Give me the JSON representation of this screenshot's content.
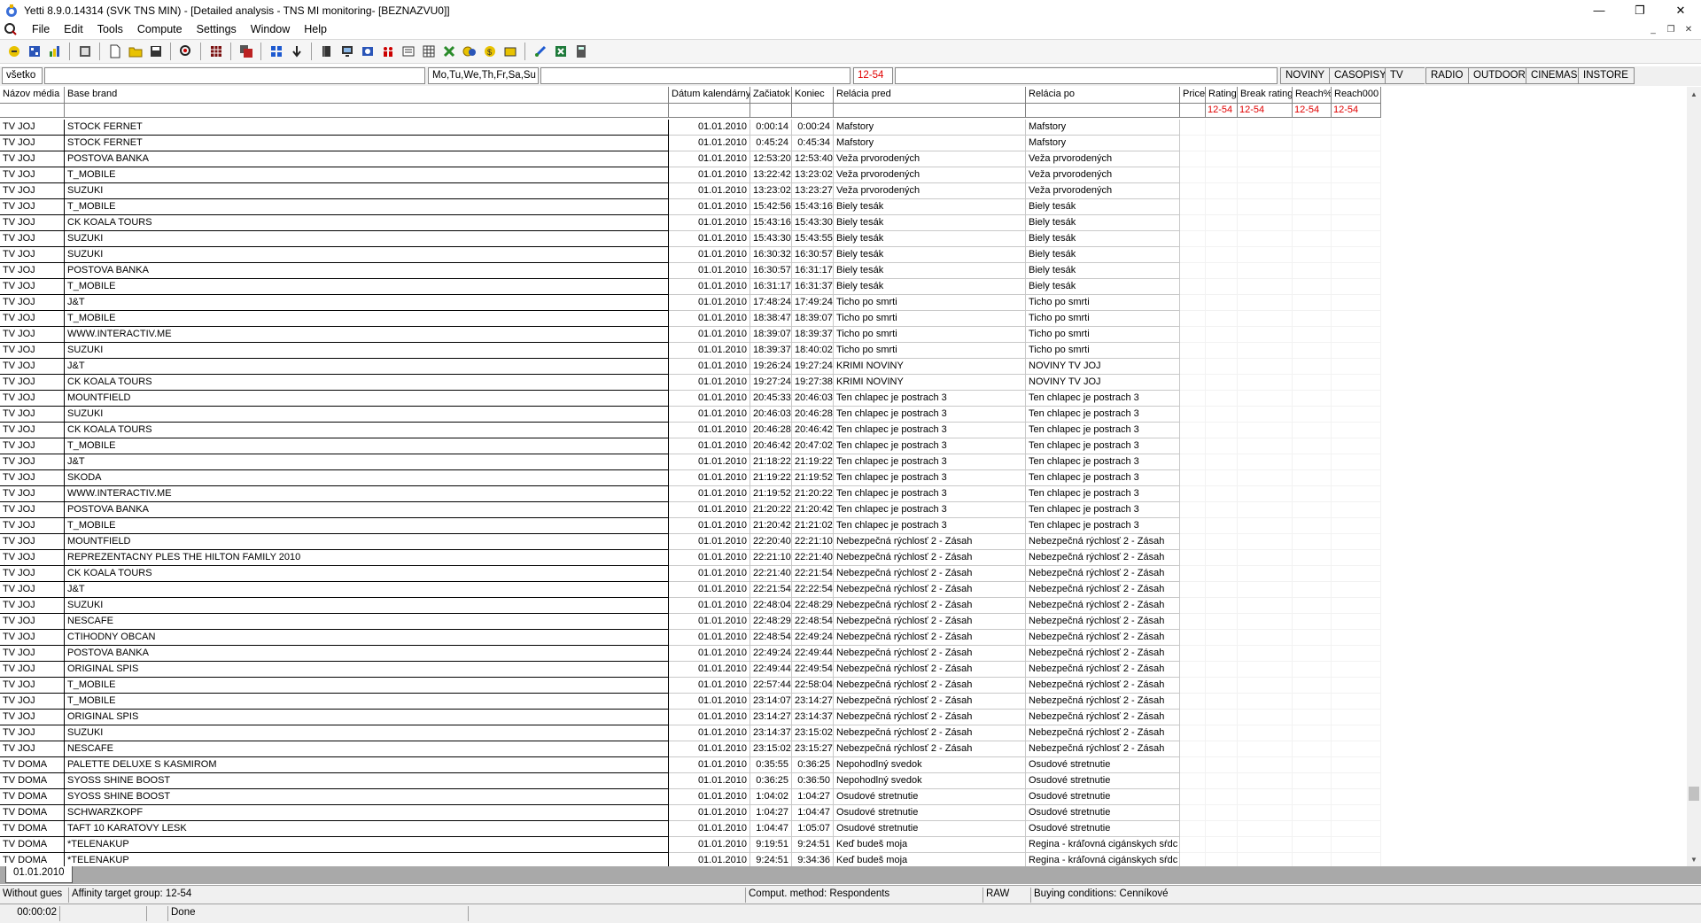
{
  "window": {
    "title": "Yetti 8.9.0.14314 (SVK TNS MIN) - [Detailed analysis - TNS MI monitoring- [BEZNAZVU0]]"
  },
  "menu": [
    "File",
    "Edit",
    "Tools",
    "Compute",
    "Settings",
    "Window",
    "Help"
  ],
  "filter": {
    "all": "všetko",
    "days": "Mo,Tu,We,Th,Fr,Sa,Su",
    "age": "12-54"
  },
  "media_tabs": [
    "NOVINY",
    "CASOPISY",
    "TV",
    "RADIO",
    "OUTDOOR",
    "CINEMAS",
    "INSTORE"
  ],
  "columns": {
    "media": "Názov média",
    "brand": "Base brand",
    "date": "Dátum kalendárny",
    "start": "Začiatok",
    "end": "Koniec",
    "before": "Relácia pred",
    "after": "Relácia po",
    "price": "Price",
    "rating": "Rating",
    "break_rating": "Break rating",
    "reach_pct": "Reach%",
    "reach000": "Reach000"
  },
  "target_labels": [
    "12-54",
    "12-54",
    "12-54",
    "12-54"
  ],
  "rows": [
    [
      "TV JOJ",
      "STOCK FERNET",
      "01.01.2010",
      "0:00:14",
      "0:00:24",
      "Mafstory",
      "Mafstory"
    ],
    [
      "TV JOJ",
      "STOCK FERNET",
      "01.01.2010",
      "0:45:24",
      "0:45:34",
      "Mafstory",
      "Mafstory"
    ],
    [
      "TV JOJ",
      "POSTOVA BANKA",
      "01.01.2010",
      "12:53:20",
      "12:53:40",
      "Veža prvorodených",
      "Veža prvorodených"
    ],
    [
      "TV JOJ",
      "T_MOBILE",
      "01.01.2010",
      "13:22:42",
      "13:23:02",
      "Veža prvorodených",
      "Veža prvorodených"
    ],
    [
      "TV JOJ",
      "SUZUKI",
      "01.01.2010",
      "13:23:02",
      "13:23:27",
      "Veža prvorodených",
      "Veža prvorodených"
    ],
    [
      "TV JOJ",
      "T_MOBILE",
      "01.01.2010",
      "15:42:56",
      "15:43:16",
      "Biely tesák",
      "Biely tesák"
    ],
    [
      "TV JOJ",
      "CK KOALA TOURS",
      "01.01.2010",
      "15:43:16",
      "15:43:30",
      "Biely tesák",
      "Biely tesák"
    ],
    [
      "TV JOJ",
      "SUZUKI",
      "01.01.2010",
      "15:43:30",
      "15:43:55",
      "Biely tesák",
      "Biely tesák"
    ],
    [
      "TV JOJ",
      "SUZUKI",
      "01.01.2010",
      "16:30:32",
      "16:30:57",
      "Biely tesák",
      "Biely tesák"
    ],
    [
      "TV JOJ",
      "POSTOVA BANKA",
      "01.01.2010",
      "16:30:57",
      "16:31:17",
      "Biely tesák",
      "Biely tesák"
    ],
    [
      "TV JOJ",
      "T_MOBILE",
      "01.01.2010",
      "16:31:17",
      "16:31:37",
      "Biely tesák",
      "Biely tesák"
    ],
    [
      "TV JOJ",
      "J&T",
      "01.01.2010",
      "17:48:24",
      "17:49:24",
      "Ticho po smrti",
      "Ticho po smrti"
    ],
    [
      "TV JOJ",
      "T_MOBILE",
      "01.01.2010",
      "18:38:47",
      "18:39:07",
      "Ticho po smrti",
      "Ticho po smrti"
    ],
    [
      "TV JOJ",
      "WWW.INTERACTIV.ME",
      "01.01.2010",
      "18:39:07",
      "18:39:37",
      "Ticho po smrti",
      "Ticho po smrti"
    ],
    [
      "TV JOJ",
      "SUZUKI",
      "01.01.2010",
      "18:39:37",
      "18:40:02",
      "Ticho po smrti",
      "Ticho po smrti"
    ],
    [
      "TV JOJ",
      "J&T",
      "01.01.2010",
      "19:26:24",
      "19:27:24",
      "KRIMI NOVINY",
      "NOVINY TV JOJ"
    ],
    [
      "TV JOJ",
      "CK KOALA TOURS",
      "01.01.2010",
      "19:27:24",
      "19:27:38",
      "KRIMI NOVINY",
      "NOVINY TV JOJ"
    ],
    [
      "TV JOJ",
      "MOUNTFIELD",
      "01.01.2010",
      "20:45:33",
      "20:46:03",
      "Ten chlapec je postrach 3",
      "Ten chlapec je postrach 3"
    ],
    [
      "TV JOJ",
      "SUZUKI",
      "01.01.2010",
      "20:46:03",
      "20:46:28",
      "Ten chlapec je postrach 3",
      "Ten chlapec je postrach 3"
    ],
    [
      "TV JOJ",
      "CK KOALA TOURS",
      "01.01.2010",
      "20:46:28",
      "20:46:42",
      "Ten chlapec je postrach 3",
      "Ten chlapec je postrach 3"
    ],
    [
      "TV JOJ",
      "T_MOBILE",
      "01.01.2010",
      "20:46:42",
      "20:47:02",
      "Ten chlapec je postrach 3",
      "Ten chlapec je postrach 3"
    ],
    [
      "TV JOJ",
      "J&T",
      "01.01.2010",
      "21:18:22",
      "21:19:22",
      "Ten chlapec je postrach 3",
      "Ten chlapec je postrach 3"
    ],
    [
      "TV JOJ",
      "SKODA",
      "01.01.2010",
      "21:19:22",
      "21:19:52",
      "Ten chlapec je postrach 3",
      "Ten chlapec je postrach 3"
    ],
    [
      "TV JOJ",
      "WWW.INTERACTIV.ME",
      "01.01.2010",
      "21:19:52",
      "21:20:22",
      "Ten chlapec je postrach 3",
      "Ten chlapec je postrach 3"
    ],
    [
      "TV JOJ",
      "POSTOVA BANKA",
      "01.01.2010",
      "21:20:22",
      "21:20:42",
      "Ten chlapec je postrach 3",
      "Ten chlapec je postrach 3"
    ],
    [
      "TV JOJ",
      "T_MOBILE",
      "01.01.2010",
      "21:20:42",
      "21:21:02",
      "Ten chlapec je postrach 3",
      "Ten chlapec je postrach 3"
    ],
    [
      "TV JOJ",
      "MOUNTFIELD",
      "01.01.2010",
      "22:20:40",
      "22:21:10",
      "Nebezpečná rýchlosť 2 - Zásah",
      "Nebezpečná rýchlosť 2 - Zásah"
    ],
    [
      "TV JOJ",
      "REPREZENTACNY PLES THE HILTON FAMILY 2010",
      "01.01.2010",
      "22:21:10",
      "22:21:40",
      "Nebezpečná rýchlosť 2 - Zásah",
      "Nebezpečná rýchlosť 2 - Zásah"
    ],
    [
      "TV JOJ",
      "CK KOALA TOURS",
      "01.01.2010",
      "22:21:40",
      "22:21:54",
      "Nebezpečná rýchlosť 2 - Zásah",
      "Nebezpečná rýchlosť 2 - Zásah"
    ],
    [
      "TV JOJ",
      "J&T",
      "01.01.2010",
      "22:21:54",
      "22:22:54",
      "Nebezpečná rýchlosť 2 - Zásah",
      "Nebezpečná rýchlosť 2 - Zásah"
    ],
    [
      "TV JOJ",
      "SUZUKI",
      "01.01.2010",
      "22:48:04",
      "22:48:29",
      "Nebezpečná rýchlosť 2 - Zásah",
      "Nebezpečná rýchlosť 2 - Zásah"
    ],
    [
      "TV JOJ",
      "NESCAFE",
      "01.01.2010",
      "22:48:29",
      "22:48:54",
      "Nebezpečná rýchlosť 2 - Zásah",
      "Nebezpečná rýchlosť 2 - Zásah"
    ],
    [
      "TV JOJ",
      "CTIHODNY OBCAN",
      "01.01.2010",
      "22:48:54",
      "22:49:24",
      "Nebezpečná rýchlosť 2 - Zásah",
      "Nebezpečná rýchlosť 2 - Zásah"
    ],
    [
      "TV JOJ",
      "POSTOVA BANKA",
      "01.01.2010",
      "22:49:24",
      "22:49:44",
      "Nebezpečná rýchlosť 2 - Zásah",
      "Nebezpečná rýchlosť 2 - Zásah"
    ],
    [
      "TV JOJ",
      "ORIGINAL SPIS",
      "01.01.2010",
      "22:49:44",
      "22:49:54",
      "Nebezpečná rýchlosť 2 - Zásah",
      "Nebezpečná rýchlosť 2 - Zásah"
    ],
    [
      "TV JOJ",
      "T_MOBILE",
      "01.01.2010",
      "22:57:44",
      "22:58:04",
      "Nebezpečná rýchlosť 2 - Zásah",
      "Nebezpečná rýchlosť 2 - Zásah"
    ],
    [
      "TV JOJ",
      "T_MOBILE",
      "01.01.2010",
      "23:14:07",
      "23:14:27",
      "Nebezpečná rýchlosť 2 - Zásah",
      "Nebezpečná rýchlosť 2 - Zásah"
    ],
    [
      "TV JOJ",
      "ORIGINAL SPIS",
      "01.01.2010",
      "23:14:27",
      "23:14:37",
      "Nebezpečná rýchlosť 2 - Zásah",
      "Nebezpečná rýchlosť 2 - Zásah"
    ],
    [
      "TV JOJ",
      "SUZUKI",
      "01.01.2010",
      "23:14:37",
      "23:15:02",
      "Nebezpečná rýchlosť 2 - Zásah",
      "Nebezpečná rýchlosť 2 - Zásah"
    ],
    [
      "TV JOJ",
      "NESCAFE",
      "01.01.2010",
      "23:15:02",
      "23:15:27",
      "Nebezpečná rýchlosť 2 - Zásah",
      "Nebezpečná rýchlosť 2 - Zásah"
    ],
    [
      "TV DOMA",
      "PALETTE DELUXE S KASMIROM",
      "01.01.2010",
      "0:35:55",
      "0:36:25",
      "Nepohodlný svedok",
      "Osudové stretnutie"
    ],
    [
      "TV DOMA",
      "SYOSS SHINE BOOST",
      "01.01.2010",
      "0:36:25",
      "0:36:50",
      "Nepohodlný svedok",
      "Osudové stretnutie"
    ],
    [
      "TV DOMA",
      "SYOSS SHINE BOOST",
      "01.01.2010",
      "1:04:02",
      "1:04:27",
      "Osudové stretnutie",
      "Osudové stretnutie"
    ],
    [
      "TV DOMA",
      "SCHWARZKOPF",
      "01.01.2010",
      "1:04:27",
      "1:04:47",
      "Osudové stretnutie",
      "Osudové stretnutie"
    ],
    [
      "TV DOMA",
      "TAFT 10 KARATOVY LESK",
      "01.01.2010",
      "1:04:47",
      "1:05:07",
      "Osudové stretnutie",
      "Osudové stretnutie"
    ],
    [
      "TV DOMA",
      "*TELENAKUP",
      "01.01.2010",
      "9:19:51",
      "9:24:51",
      "Keď budeš moja",
      "Regina - kráľovná cigánskych sŕdc"
    ],
    [
      "TV DOMA",
      "*TELENAKUP",
      "01.01.2010",
      "9:24:51",
      "9:34:36",
      "Keď budeš moja",
      "Regina - kráľovná cigánskych sŕdc"
    ]
  ],
  "sheet_tab": "01.01.2010",
  "status": {
    "guest": "Without gues",
    "affinity": "Affinity target group: 12-54",
    "method": "Comput. method: Respondents",
    "raw": "RAW",
    "buying": "Buying conditions: Cenníkové",
    "timer": "00:00:02",
    "state": "Done"
  }
}
